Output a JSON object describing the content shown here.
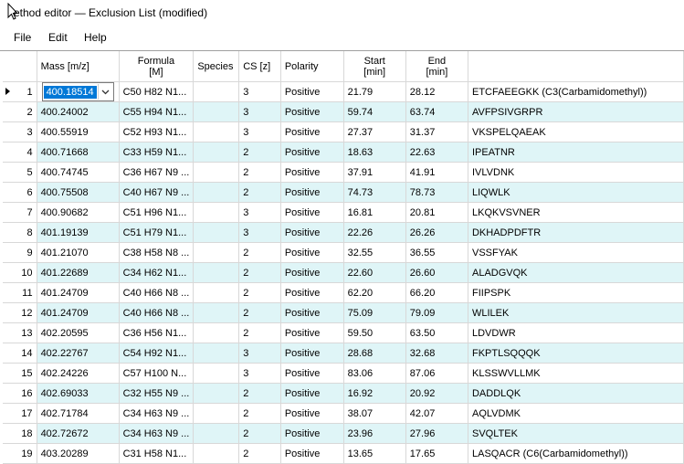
{
  "window": {
    "title": "ethod editor — Exclusion List (modified)"
  },
  "menu": {
    "items": [
      "File",
      "Edit",
      "Help"
    ]
  },
  "grid": {
    "columns": [
      {
        "label": "Mass [m/z]"
      },
      {
        "label": "Formula\n[M]"
      },
      {
        "label": "Species"
      },
      {
        "label": "CS [z]"
      },
      {
        "label": "Polarity"
      },
      {
        "label": "Start\n[min]"
      },
      {
        "label": "End\n[min]"
      },
      {
        "label": ""
      }
    ],
    "rows": [
      {
        "n": "1",
        "mass": "400.18514",
        "formula": "C50 H82 N1...",
        "species": "",
        "cs": "3",
        "polarity": "Positive",
        "start": "21.79",
        "end": "28.12",
        "name": "ETCFAEEGKK (C3(Carbamidomethyl))"
      },
      {
        "n": "2",
        "mass": "400.24002",
        "formula": "C55 H94 N1...",
        "species": "",
        "cs": "3",
        "polarity": "Positive",
        "start": "59.74",
        "end": "63.74",
        "name": "AVFPSIVGRPR"
      },
      {
        "n": "3",
        "mass": "400.55919",
        "formula": "C52 H93 N1...",
        "species": "",
        "cs": "3",
        "polarity": "Positive",
        "start": "27.37",
        "end": "31.37",
        "name": "VKSPELQAEAK"
      },
      {
        "n": "4",
        "mass": "400.71668",
        "formula": "C33 H59 N1...",
        "species": "",
        "cs": "2",
        "polarity": "Positive",
        "start": "18.63",
        "end": "22.63",
        "name": "IPEATNR"
      },
      {
        "n": "5",
        "mass": "400.74745",
        "formula": "C36 H67 N9 ...",
        "species": "",
        "cs": "2",
        "polarity": "Positive",
        "start": "37.91",
        "end": "41.91",
        "name": "IVLVDNK"
      },
      {
        "n": "6",
        "mass": "400.75508",
        "formula": "C40 H67 N9 ...",
        "species": "",
        "cs": "2",
        "polarity": "Positive",
        "start": "74.73",
        "end": "78.73",
        "name": "LIQWLK"
      },
      {
        "n": "7",
        "mass": "400.90682",
        "formula": "C51 H96 N1...",
        "species": "",
        "cs": "3",
        "polarity": "Positive",
        "start": "16.81",
        "end": "20.81",
        "name": "LKQKVSVNER"
      },
      {
        "n": "8",
        "mass": "401.19139",
        "formula": "C51 H79 N1...",
        "species": "",
        "cs": "3",
        "polarity": "Positive",
        "start": "22.26",
        "end": "26.26",
        "name": "DKHADPDFTR"
      },
      {
        "n": "9",
        "mass": "401.21070",
        "formula": "C38 H58 N8 ...",
        "species": "",
        "cs": "2",
        "polarity": "Positive",
        "start": "32.55",
        "end": "36.55",
        "name": "VSSFYAK"
      },
      {
        "n": "10",
        "mass": "401.22689",
        "formula": "C34 H62 N1...",
        "species": "",
        "cs": "2",
        "polarity": "Positive",
        "start": "22.60",
        "end": "26.60",
        "name": "ALADGVQK"
      },
      {
        "n": "11",
        "mass": "401.24709",
        "formula": "C40 H66 N8 ...",
        "species": "",
        "cs": "2",
        "polarity": "Positive",
        "start": "62.20",
        "end": "66.20",
        "name": "FIIPSPK"
      },
      {
        "n": "12",
        "mass": "401.24709",
        "formula": "C40 H66 N8 ...",
        "species": "",
        "cs": "2",
        "polarity": "Positive",
        "start": "75.09",
        "end": "79.09",
        "name": "WLILEK"
      },
      {
        "n": "13",
        "mass": "402.20595",
        "formula": "C36 H56 N1...",
        "species": "",
        "cs": "2",
        "polarity": "Positive",
        "start": "59.50",
        "end": "63.50",
        "name": "LDVDWR"
      },
      {
        "n": "14",
        "mass": "402.22767",
        "formula": "C54 H92 N1...",
        "species": "",
        "cs": "3",
        "polarity": "Positive",
        "start": "28.68",
        "end": "32.68",
        "name": "FKPTLSQQQK"
      },
      {
        "n": "15",
        "mass": "402.24226",
        "formula": "C57 H100 N...",
        "species": "",
        "cs": "3",
        "polarity": "Positive",
        "start": "83.06",
        "end": "87.06",
        "name": "KLSSWVLLMK"
      },
      {
        "n": "16",
        "mass": "402.69033",
        "formula": "C32 H55 N9 ...",
        "species": "",
        "cs": "2",
        "polarity": "Positive",
        "start": "16.92",
        "end": "20.92",
        "name": "DADDLQK"
      },
      {
        "n": "17",
        "mass": "402.71784",
        "formula": "C34 H63 N9 ...",
        "species": "",
        "cs": "2",
        "polarity": "Positive",
        "start": "38.07",
        "end": "42.07",
        "name": "AQLVDMK"
      },
      {
        "n": "18",
        "mass": "402.72672",
        "formula": "C34 H63 N9 ...",
        "species": "",
        "cs": "2",
        "polarity": "Positive",
        "start": "23.96",
        "end": "27.96",
        "name": "SVQLTEK"
      },
      {
        "n": "19",
        "mass": "403.20289",
        "formula": "C31 H58 N1...",
        "species": "",
        "cs": "2",
        "polarity": "Positive",
        "start": "13.65",
        "end": "17.65",
        "name": "LASQACR (C6(Carbamidomethyl))"
      }
    ]
  },
  "colors": {
    "alt_row": "#dff5f7",
    "selection": "#0078d7"
  }
}
